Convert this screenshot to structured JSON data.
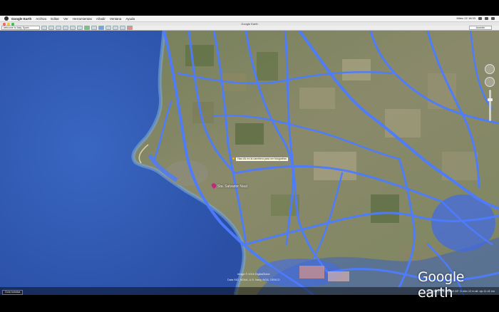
{
  "menubar": {
    "app_name": "Google Earth",
    "items": [
      "Archivo",
      "Editar",
      "Ver",
      "Herramientas",
      "Añadir",
      "Ventana",
      "Ayuda"
    ],
    "clock": "Miérc 22 18:33"
  },
  "window": {
    "title": "Google Earth"
  },
  "toolbar": {
    "search_value": "welcome to Italy, Spain",
    "account_label": "Acceder"
  },
  "map": {
    "place_label": "Sta. Salvador Naut",
    "tooltip": "Haz clic en la carretera para ver fotografías"
  },
  "footer": {
    "attribution_line1": "Image © 2015 DigitalGlobe",
    "attribution_line2": "Data SIO, NOAA, U.S. Navy, NGA, GEBCO",
    "logo_text": "Google earth",
    "tour_button": "Guía turística",
    "coordinates": "36°38'35.17\" N   6°18'12.33\" O   elev  12 m   alt. ojo 11.41 km"
  },
  "colors": {
    "ocean": "#2e57b3",
    "road": "#4d7cff",
    "land": "#6b7a52"
  }
}
